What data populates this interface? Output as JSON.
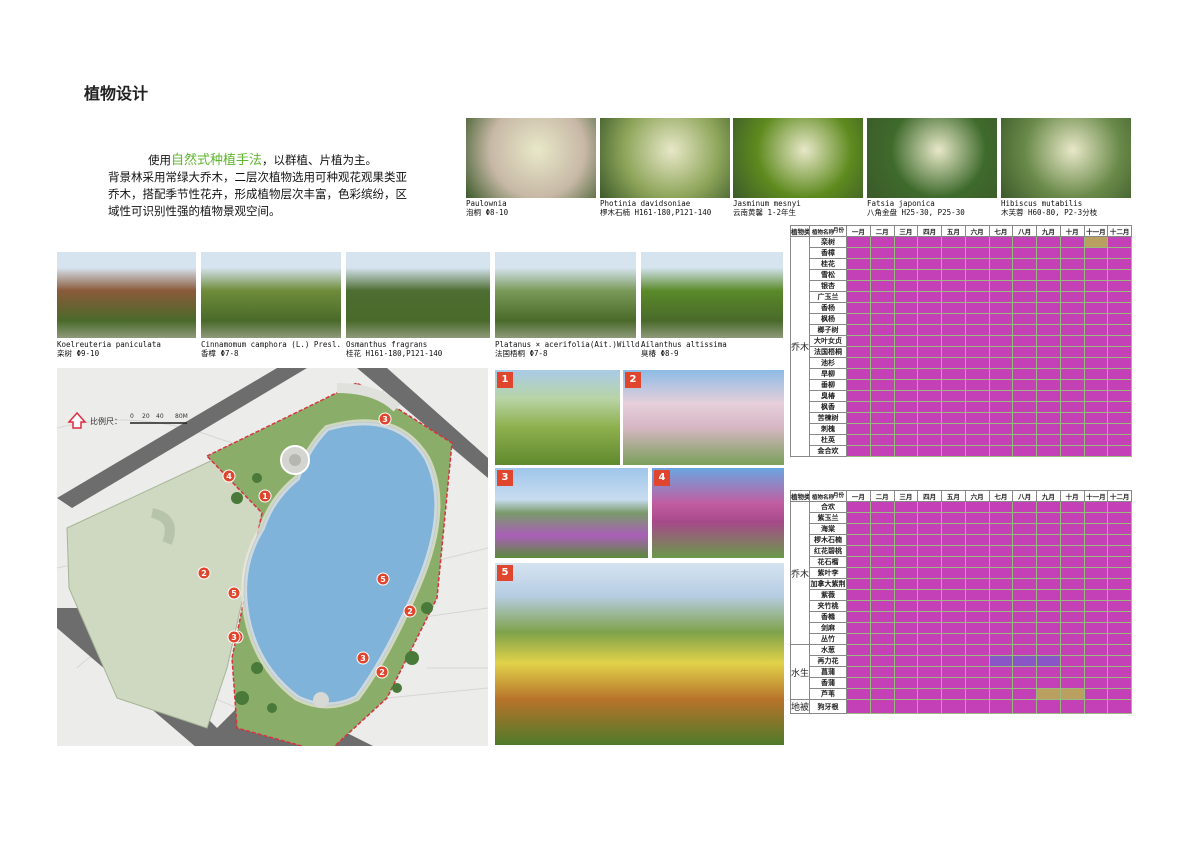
{
  "page": {
    "title": "植物设计",
    "intro_prefix": "使用",
    "intro_highlight": "自然式种植手法",
    "intro_suffix": "，以群植、片植为主。",
    "intro_body": "背景林采用常绿大乔木，二层次植物选用可种观花观果类亚乔木，搭配季节性花卉，形成植物层次丰富，色彩缤纷，区域性可识别性强的植物景观空间。"
  },
  "top_photos": [
    {
      "latin": "Paulownia",
      "cn": "泡桐",
      "spec": "Φ8-10",
      "color": "#c7b8a6"
    },
    {
      "latin": "Photinia davidsoniae",
      "cn": "椤木石楠",
      "spec": "H161-180,P121-140",
      "color": "#8ea55a"
    },
    {
      "latin": "Jasminum mesnyi",
      "cn": "云南黄馨",
      "spec": "1-2年生",
      "color": "#5e8a1e"
    },
    {
      "latin": "Fatsia japonica",
      "cn": "八角金盘",
      "spec": "H25-30, P25-30",
      "color": "#3e6a2c"
    },
    {
      "latin": "Hibiscus mutabilis",
      "cn": "木芙蓉",
      "spec": "H60-80, P2-3分枝",
      "color": "#6a8a4a"
    }
  ],
  "mid_photos": [
    {
      "latin": "Koelreuteria paniculata",
      "cn": "栾树",
      "spec": "Φ9-10",
      "color": "#8a5a3a"
    },
    {
      "latin": "Cinnamomum camphora (L.) Presl.",
      "cn": "香樟",
      "spec": "Φ7-8",
      "color": "#6e8c3a"
    },
    {
      "latin": "Osmanthus fragrans",
      "cn": "桂花",
      "spec": "H161-180,P121-140",
      "color": "#4e6e32"
    },
    {
      "latin": "Platanus × acerifolia(Ait.)Willd.",
      "cn": "法国梧桐",
      "spec": "Φ7-8",
      "color": "#7a9a5a"
    },
    {
      "latin": "Ailanthus altissima",
      "cn": "臭椿",
      "spec": "Φ8-9",
      "color": "#5a8a2a"
    }
  ],
  "scene_photos": [
    {
      "num": "1",
      "color": "#8fb04e"
    },
    {
      "num": "2",
      "color": "#d7b7c4"
    },
    {
      "num": "3",
      "color": "#a95fb8"
    },
    {
      "num": "4",
      "color": "#c25ca0"
    },
    {
      "num": "5",
      "color": "#7ea24a"
    }
  ],
  "map": {
    "scale_label": "比例尺：",
    "scale_ticks": [
      "0",
      "20",
      "40",
      "80M"
    ],
    "markers": [
      "1",
      "2",
      "3",
      "4",
      "5",
      "2",
      "3",
      "5",
      "3",
      "2",
      "3"
    ]
  },
  "table1": {
    "col_category": "植物类别",
    "hdr_month": "月份",
    "hdr_name": "植物名称",
    "months": [
      "一月",
      "二月",
      "三月",
      "四月",
      "五月",
      "六月",
      "七月",
      "八月",
      "九月",
      "十月",
      "十一月",
      "十二月"
    ],
    "category": "乔木",
    "rows": [
      {
        "name": "栾树",
        "cells": [
          "w",
          "w",
          "w",
          "w",
          "w",
          "y",
          "ly",
          "ly",
          "ly",
          "ly",
          "br",
          "o"
        ]
      },
      {
        "name": "香樟",
        "cells": [
          "m",
          "m",
          "m",
          "m",
          "m",
          "m",
          "m",
          "m",
          "m",
          "m",
          "m",
          "m"
        ]
      },
      {
        "name": "桂花",
        "cells": [
          "m",
          "m",
          "m",
          "m",
          "m",
          "m",
          "m",
          "m",
          "ly",
          "ly",
          "m",
          "m"
        ]
      },
      {
        "name": "雪松",
        "cells": [
          "m",
          "m",
          "m",
          "m",
          "m",
          "m",
          "m",
          "m",
          "m",
          "m",
          "m",
          "m"
        ]
      },
      {
        "name": "银杏",
        "cells": [
          "w",
          "w",
          "lg",
          "lg",
          "ly",
          "ly",
          "ly",
          "lg",
          "lg",
          "y",
          "y",
          "w"
        ]
      },
      {
        "name": "广玉兰",
        "cells": [
          "m",
          "m",
          "m",
          "m",
          "ly",
          "m",
          "m",
          "m",
          "m",
          "m",
          "m",
          "m"
        ]
      },
      {
        "name": "香杨",
        "cells": [
          "m",
          "m",
          "m",
          "m",
          "m",
          "m",
          "m",
          "m",
          "m",
          "m",
          "m",
          "m"
        ]
      },
      {
        "name": "枫杨",
        "cells": [
          "w",
          "w",
          "m",
          "y",
          "m",
          "m",
          "m",
          "m",
          "m",
          "m",
          "m",
          "w"
        ]
      },
      {
        "name": "榔子树",
        "cells": [
          "m",
          "m",
          "m",
          "m",
          "m",
          "m",
          "o",
          "o",
          "o",
          "o",
          "m",
          "m"
        ]
      },
      {
        "name": "大叶女贞",
        "cells": [
          "m",
          "m",
          "m",
          "m",
          "m",
          "m",
          "m",
          "m",
          "m",
          "m",
          "m",
          "m"
        ]
      },
      {
        "name": "法国梧桐",
        "cells": [
          "w",
          "w",
          "lg",
          "lg",
          "m",
          "m",
          "m",
          "m",
          "ly",
          "y",
          "w",
          "w"
        ]
      },
      {
        "name": "池杉",
        "cells": [
          "w",
          "w",
          "m",
          "m",
          "m",
          "m",
          "m",
          "m",
          "m",
          "m",
          "m",
          "w"
        ]
      },
      {
        "name": "旱柳",
        "cells": [
          "w",
          "lg",
          "lg",
          "m",
          "m",
          "m",
          "m",
          "m",
          "m",
          "m",
          "m",
          "w"
        ]
      },
      {
        "name": "垂柳",
        "cells": [
          "w",
          "lg",
          "lg",
          "m",
          "m",
          "m",
          "m",
          "m",
          "m",
          "m",
          "m",
          "w"
        ]
      },
      {
        "name": "臭椿",
        "cells": [
          "w",
          "w",
          "lg",
          "ly",
          "ly",
          "y",
          "y",
          "y",
          "y",
          "y",
          "m",
          "w"
        ]
      },
      {
        "name": "枫香",
        "cells": [
          "w",
          "w",
          "lg",
          "m",
          "m",
          "m",
          "m",
          "m",
          "m",
          "o",
          "o",
          "w"
        ]
      },
      {
        "name": "苦楝树",
        "cells": [
          "w",
          "w",
          "lg",
          "p",
          "p",
          "lg",
          "m",
          "m",
          "lg",
          "lg",
          "y",
          "w"
        ]
      },
      {
        "name": "刺槐",
        "cells": [
          "w",
          "w",
          "lg",
          "y",
          "y",
          "m",
          "m",
          "m",
          "m",
          "m",
          "lg",
          "w"
        ]
      },
      {
        "name": "杜英",
        "cells": [
          "m",
          "m",
          "m",
          "m",
          "m",
          "m",
          "m",
          "m",
          "m",
          "m",
          "m",
          "o"
        ]
      },
      {
        "name": "金合欢",
        "cells": [
          "w",
          "y",
          "y",
          "m",
          "m",
          "m",
          "m",
          "m",
          "m",
          "m",
          "m",
          "w"
        ]
      }
    ]
  },
  "table2": {
    "col_category": "植物类别",
    "hdr_month": "月份",
    "hdr_name": "植物名称",
    "months": [
      "一月",
      "二月",
      "三月",
      "四月",
      "五月",
      "六月",
      "七月",
      "八月",
      "九月",
      "十月",
      "十一月",
      "十二月"
    ],
    "groups": [
      {
        "category": "乔木",
        "rows": [
          {
            "name": "合欢",
            "cells": [
              "w",
              "w",
              "w",
              "w",
              "m",
              "pk",
              "pk",
              "m",
              "m",
              "m",
              "w",
              "w"
            ]
          },
          {
            "name": "紫玉兰",
            "cells": [
              "w",
              "w",
              "p",
              "p",
              "m",
              "m",
              "m",
              "m",
              "m",
              "m",
              "m",
              "w"
            ]
          },
          {
            "name": "海棠",
            "cells": [
              "w",
              "w",
              "lg",
              "pk",
              "pk",
              "m",
              "m",
              "m",
              "m",
              "m",
              "m",
              "w"
            ]
          },
          {
            "name": "椤木石楠",
            "cells": [
              "m",
              "m",
              "m",
              "ly",
              "m",
              "m",
              "m",
              "m",
              "m",
              "m",
              "m",
              "m"
            ]
          },
          {
            "name": "红花碧桃",
            "cells": [
              "w",
              "w",
              "r",
              "r",
              "m",
              "m",
              "m",
              "m",
              "m",
              "m",
              "m",
              "w"
            ]
          },
          {
            "name": "花石榴",
            "cells": [
              "w",
              "w",
              "lg",
              "m",
              "r",
              "r",
              "r",
              "r",
              "r",
              "m",
              "m",
              "w"
            ]
          },
          {
            "name": "紫叶李",
            "cells": [
              "m",
              "m",
              "pk",
              "m",
              "r",
              "r",
              "r",
              "r",
              "r",
              "r",
              "m",
              "m"
            ]
          },
          {
            "name": "加拿大紫荆",
            "cells": [
              "w",
              "w",
              "m",
              "m",
              "m",
              "m",
              "m",
              "m",
              "m",
              "m",
              "m",
              "w"
            ]
          },
          {
            "name": "紫薇",
            "cells": [
              "w",
              "w",
              "lg",
              "m",
              "m",
              "m",
              "m",
              "m",
              "m",
              "m",
              "m",
              "w"
            ]
          },
          {
            "name": "夹竹桃",
            "cells": [
              "m",
              "m",
              "m",
              "m",
              "pk",
              "pk",
              "r",
              "r",
              "r",
              "r",
              "m",
              "m"
            ]
          },
          {
            "name": "香橼",
            "cells": [
              "m",
              "m",
              "m",
              "y",
              "m",
              "m",
              "m",
              "m",
              "m",
              "y",
              "y",
              "m"
            ]
          },
          {
            "name": "剑麻",
            "cells": [
              "m",
              "m",
              "m",
              "m",
              "m",
              "m",
              "ly",
              "ly",
              "m",
              "m",
              "m",
              "m"
            ]
          },
          {
            "name": "丛竹",
            "cells": [
              "m",
              "m",
              "m",
              "m",
              "m",
              "m",
              "m",
              "m",
              "m",
              "m",
              "m",
              "m"
            ]
          }
        ]
      },
      {
        "category": "水生",
        "rows": [
          {
            "name": "水葱",
            "cells": [
              "w",
              "w",
              "lg",
              "m",
              "m",
              "m",
              "m",
              "m",
              "m",
              "m",
              "m",
              "w"
            ]
          },
          {
            "name": "再力花",
            "cells": [
              "w",
              "w",
              "m",
              "m",
              "m",
              "m",
              "v",
              "v",
              "v",
              "m",
              "m",
              "w"
            ]
          },
          {
            "name": "菖蒲",
            "cells": [
              "w",
              "w",
              "lg",
              "ly",
              "m",
              "m",
              "m",
              "m",
              "m",
              "m",
              "m",
              "w"
            ]
          },
          {
            "name": "香蒲",
            "cells": [
              "w",
              "w",
              "m",
              "m",
              "o",
              "o",
              "o",
              "o",
              "m",
              "m",
              "m",
              "w"
            ]
          },
          {
            "name": "芦苇",
            "cells": [
              "w",
              "w",
              "lg",
              "m",
              "m",
              "m",
              "m",
              "m",
              "br",
              "br",
              "m",
              "w"
            ]
          }
        ]
      },
      {
        "category": "地被",
        "rows": [
          {
            "name": "狗牙根",
            "cells": [
              "ly",
              "m",
              "m",
              "m",
              "m",
              "m",
              "m",
              "m",
              "m",
              "m",
              "m",
              "ly"
            ]
          }
        ]
      }
    ]
  }
}
